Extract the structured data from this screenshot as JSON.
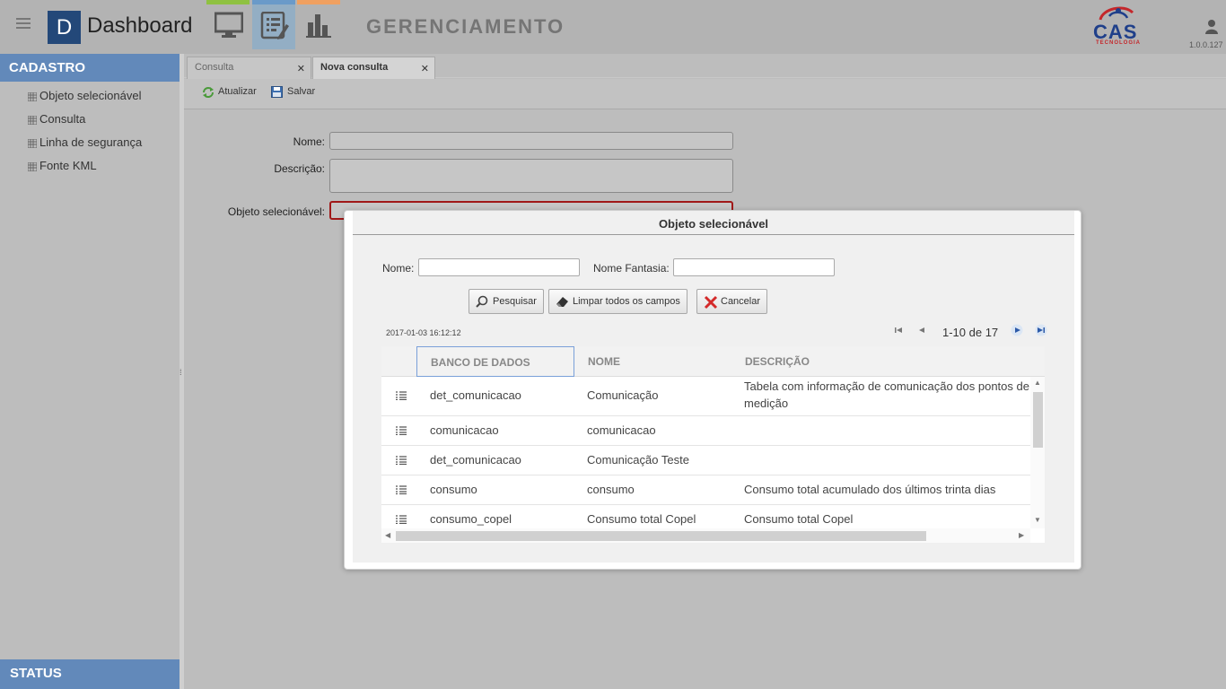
{
  "header": {
    "logo_letter": "D",
    "logo_text": "Dashboard",
    "app_title": "GERENCIAMENTO",
    "company_logo_text": "CAS",
    "company_logo_sub": "TECNOLOGIA",
    "version": "1.0.0.127",
    "nav_colors": {
      "monitor": "#8fc141",
      "edit": "#6a9ac9",
      "chart": "#f0a060"
    }
  },
  "sidebar": {
    "title": "CADASTRO",
    "items": [
      {
        "label": "Objeto selecionável"
      },
      {
        "label": "Consulta"
      },
      {
        "label": "Linha de segurança"
      },
      {
        "label": "Fonte KML"
      }
    ],
    "status": "STATUS"
  },
  "tabs": [
    {
      "label": "Consulta"
    },
    {
      "label": "Nova consulta"
    }
  ],
  "toolbar": {
    "refresh_label": "Atualizar",
    "save_label": "Salvar"
  },
  "form": {
    "name_label": "Nome:",
    "description_label": "Descrição:",
    "object_label": "Objeto selecionável:"
  },
  "dialog": {
    "title": "Objeto selecionável",
    "name_label": "Nome:",
    "fantasy_label": "Nome Fantasia:",
    "search_button": "Pesquisar",
    "clear_button": "Limpar todos os campos",
    "cancel_button": "Cancelar",
    "timestamp": "2017-01-03 16:12:12",
    "pager": "1-10 de 17",
    "columns": [
      "BANCO DE DADOS",
      "NOME",
      "DESCRIÇÃO"
    ],
    "rows": [
      {
        "db": "det_comunicacao",
        "name": "Comunicação",
        "desc": "Tabela com informação de comunicação dos pontos de medição"
      },
      {
        "db": "comunicacao",
        "name": "comunicacao",
        "desc": ""
      },
      {
        "db": "det_comunicacao",
        "name": "Comunicação Teste",
        "desc": ""
      },
      {
        "db": "consumo",
        "name": "consumo",
        "desc": "Consumo total acumulado dos últimos trinta dias"
      },
      {
        "db": "consumo_copel",
        "name": "Consumo total Copel",
        "desc": "Consumo total Copel"
      }
    ]
  }
}
